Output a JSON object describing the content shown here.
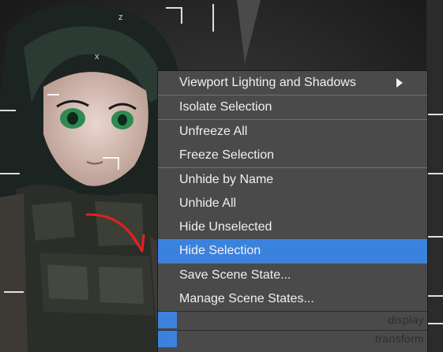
{
  "quad_menu": {
    "items": [
      {
        "label": "Viewport Lighting and Shadows",
        "has_submenu": true
      },
      {
        "label": "Isolate Selection"
      },
      {
        "label": "Unfreeze All"
      },
      {
        "label": "Freeze Selection"
      },
      {
        "label": "Unhide by Name"
      },
      {
        "label": "Unhide All"
      },
      {
        "label": "Hide Unselected"
      },
      {
        "label": "Hide Selection",
        "highlighted": true
      },
      {
        "label": "Save Scene State..."
      },
      {
        "label": "Manage Scene States..."
      }
    ],
    "quadrants": [
      {
        "label": "display"
      },
      {
        "label": "transform"
      }
    ]
  },
  "colors": {
    "menu_bg": "#4a4a4a",
    "highlight": "#3b82dc",
    "annotation_arrow": "#e02020"
  }
}
